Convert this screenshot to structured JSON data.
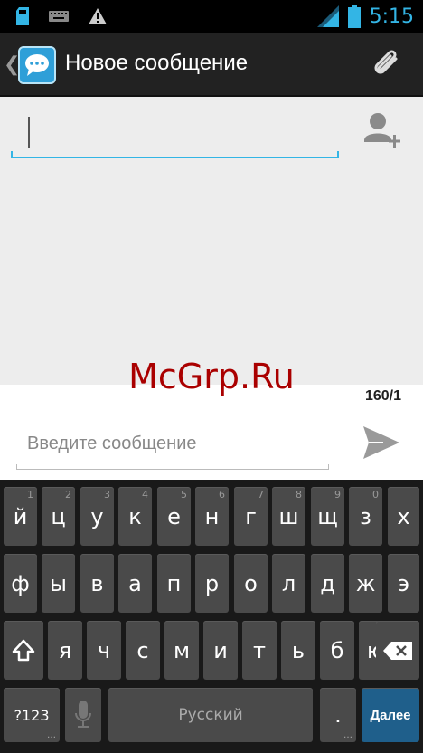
{
  "status_bar": {
    "time": "5:15",
    "icons": [
      "sd-card-icon",
      "keyboard-icon",
      "warning-icon",
      "signal-icon",
      "battery-icon"
    ]
  },
  "action_bar": {
    "title": "Новое сообщение",
    "icons": [
      "back-chevron-icon",
      "messaging-app-icon",
      "attach-paperclip-icon"
    ]
  },
  "recipient": {
    "value": "",
    "add_contact_icon": "add-contact-icon"
  },
  "compose": {
    "counter": "160/1",
    "placeholder": "Введите сообщение",
    "send_icon": "send-icon"
  },
  "watermark": "McGrp.Ru",
  "keyboard": {
    "row1": [
      {
        "key": "й",
        "hint": "1"
      },
      {
        "key": "ц",
        "hint": "2"
      },
      {
        "key": "у",
        "hint": "3"
      },
      {
        "key": "к",
        "hint": "4"
      },
      {
        "key": "е",
        "hint": "5"
      },
      {
        "key": "н",
        "hint": "6"
      },
      {
        "key": "г",
        "hint": "7"
      },
      {
        "key": "ш",
        "hint": "8"
      },
      {
        "key": "щ",
        "hint": "9"
      },
      {
        "key": "з",
        "hint": "0"
      },
      {
        "key": "х",
        "hint": ""
      }
    ],
    "row2": [
      "ф",
      "ы",
      "в",
      "а",
      "п",
      "р",
      "о",
      "л",
      "д",
      "ж",
      "э"
    ],
    "row3": [
      "я",
      "ч",
      "с",
      "м",
      "и",
      "т",
      "ь",
      "б",
      "ю"
    ],
    "symbols_label": "?123",
    "space_label": "Русский",
    "period_label": ".",
    "enter_label": "Далее",
    "colors": {
      "key": "#4a4a4a",
      "accent": "#33b5e5",
      "enter": "#1f5f8b"
    }
  }
}
